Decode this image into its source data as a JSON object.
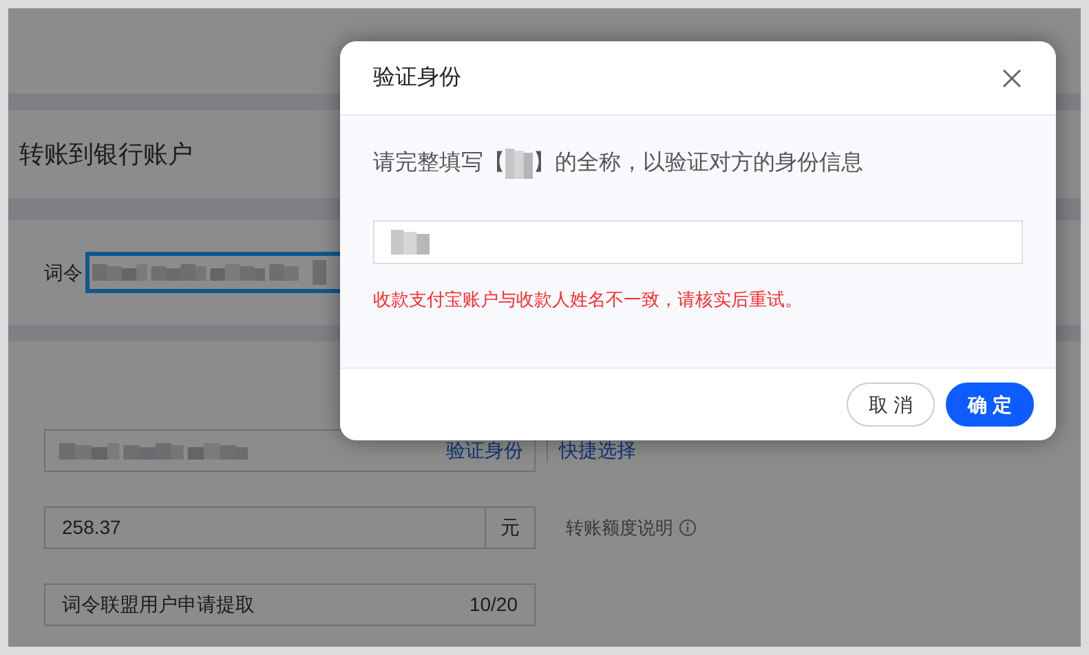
{
  "page": {
    "title": "转账到银行账户",
    "command_label": "词令",
    "command_focused": true,
    "payee_links": [
      {
        "label": "验证身份"
      },
      {
        "label": "快捷选择"
      }
    ],
    "amount": {
      "value": "258.37",
      "unit": "元"
    },
    "limit_help": "转账额度说明",
    "memo": {
      "value": "词令联盟用户申请提取",
      "counter": "10/20"
    }
  },
  "dialog": {
    "title": "验证身份",
    "prompt_before": "请完整填写【",
    "prompt_after": "】的全称，以验证对方的身份信息",
    "error": "收款支付宝账户与收款人姓名不一致，请核实后重试。",
    "buttons": [
      {
        "label": "取 消",
        "kind": "secondary"
      },
      {
        "label": "确 定",
        "kind": "primary"
      }
    ]
  }
}
